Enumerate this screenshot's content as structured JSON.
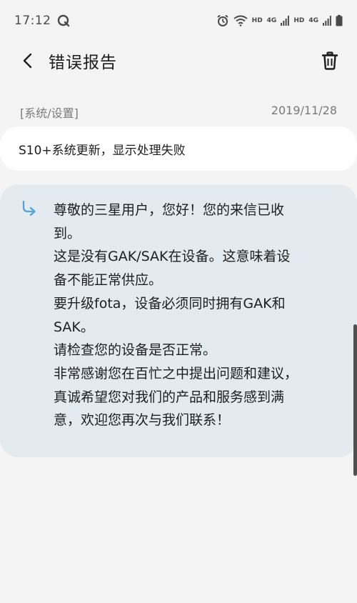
{
  "status_bar": {
    "time": "17:12",
    "network1_label": "HD",
    "network1_gen": "4G",
    "network2_label": "HD",
    "network2_gen": "4G"
  },
  "header": {
    "title": "错误报告"
  },
  "report": {
    "category": "[系统/设置]",
    "date": "2019/11/28",
    "subject": "S10+系统更新，显示处理失败"
  },
  "reply": {
    "lines": [
      "尊敬的三星用户，您好！您的来信已收",
      "到。",
      "这是没有GAK/SAK在设备。这意味着设",
      "备不能正常供应。",
      "要升级fota，设备必须同时拥有GAK和",
      "SAK。",
      "请检查您的设备是否正常。",
      "非常感谢您在百忙之中提出问题和建议，",
      "真诚希望您对我们的产品和服务感到满",
      "意，欢迎您再次与我们联系！"
    ]
  },
  "colors": {
    "background": "#f4f4f4",
    "card": "#ffffff",
    "reply_card": "#e3eaf0",
    "reply_arrow": "#4ea3d9",
    "meta_text": "#7a7a7a"
  }
}
